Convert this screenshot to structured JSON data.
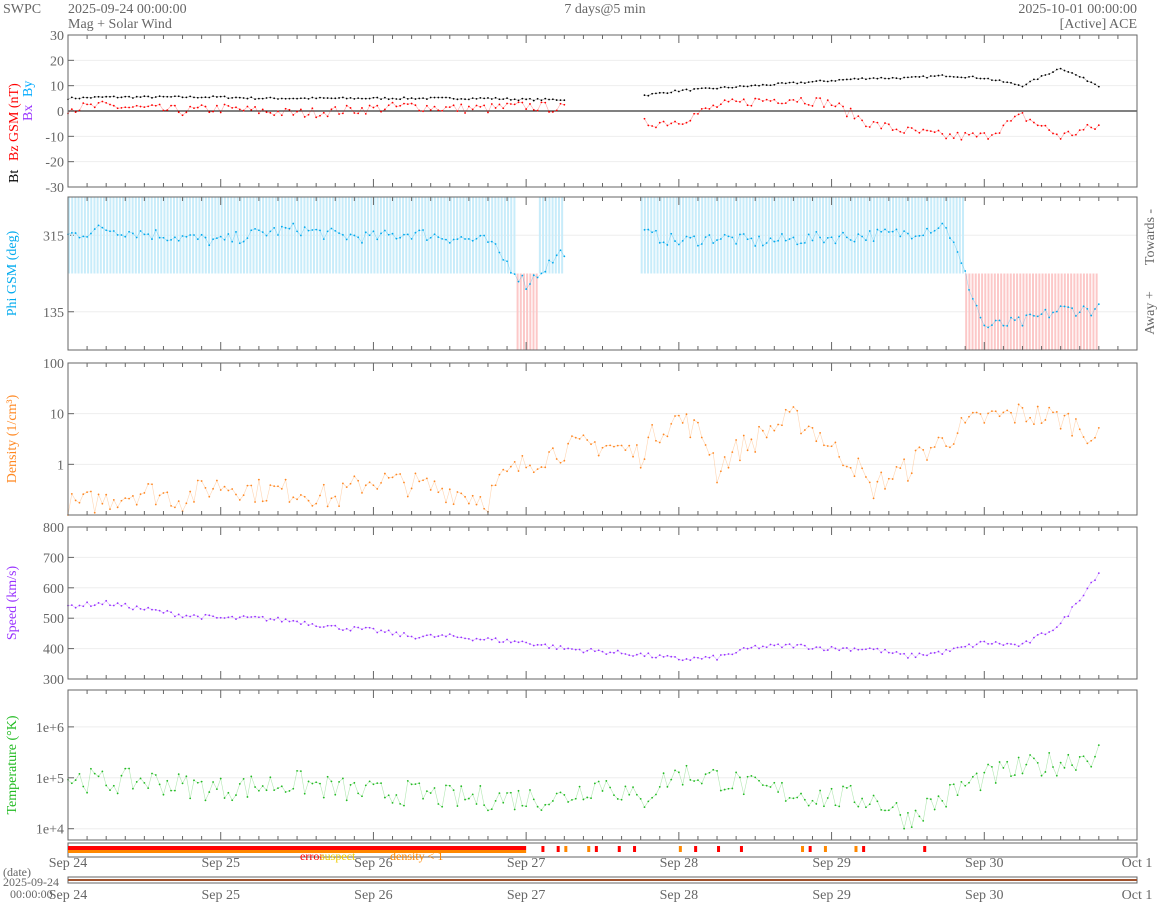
{
  "header": {
    "brand": "SWPC",
    "start": "2025-09-24 00:00:00",
    "subtitle": "Mag + Solar Wind",
    "span": "7 days@5 min",
    "end": "2025-10-01 00:00:00",
    "source": "[Active] ACE"
  },
  "chart_data": [
    {
      "type": "line",
      "title": "Mag",
      "ylabel_parts": [
        "Bt",
        "Bz GSM (nT)",
        "Bx",
        "By"
      ],
      "ylim": [
        -30,
        30
      ],
      "yticks": [
        "30",
        "20",
        "10",
        "0",
        "-10",
        "-20",
        "-30"
      ],
      "x_hours": [
        0,
        6,
        12,
        18,
        24,
        30,
        36,
        42,
        48,
        54,
        60,
        66,
        72,
        78,
        84,
        90,
        96,
        102,
        108,
        114,
        120,
        126,
        132,
        138,
        144,
        150,
        156,
        162
      ],
      "series": [
        {
          "name": "Bt",
          "color": "#000000",
          "values": [
            5,
            5.5,
            5.5,
            5.5,
            5.5,
            5,
            5,
            5,
            5,
            5,
            5,
            5,
            4.5,
            4.5,
            null,
            6,
            8,
            9,
            10,
            11,
            12,
            13,
            13,
            14,
            13,
            10,
            17,
            10
          ]
        },
        {
          "name": "Bz",
          "color": "#ff0000",
          "values": [
            1,
            2,
            1,
            0,
            1,
            0,
            -1,
            0,
            1,
            2,
            1,
            1,
            2,
            1,
            null,
            -5,
            -4,
            2,
            4,
            5,
            3,
            -5,
            -8,
            -10,
            -10,
            -2,
            -10,
            -6
          ]
        }
      ]
    },
    {
      "type": "scatter",
      "title": "Phi",
      "ylabel": "Phi GSM (deg)",
      "ylim": [
        45,
        405
      ],
      "yticks": [
        "315",
        "135"
      ],
      "right_labels": [
        "Towards -",
        "Away +"
      ],
      "series": [
        {
          "name": "Phi",
          "color": "#00aaee",
          "values": [
            315,
            330,
            320,
            310,
            300,
            320,
            330,
            315,
            310,
            320,
            310,
            300,
            200,
            280,
            null,
            320,
            300,
            310,
            300,
            305,
            310,
            315,
            320,
            340,
            100,
            110,
            140,
            140
          ]
        }
      ]
    },
    {
      "type": "line",
      "title": "Density",
      "ylabel": "Density (1/cm³)",
      "ylim": [
        0.1,
        100
      ],
      "yscale": "log",
      "yticks": [
        "100",
        "10",
        "1"
      ],
      "series": [
        {
          "name": "Density",
          "color": "#ff8822",
          "values": [
            0.15,
            0.2,
            0.3,
            0.2,
            0.4,
            0.3,
            0.3,
            0.2,
            0.5,
            0.4,
            0.3,
            0.2,
            1,
            2,
            2.5,
            1.5,
            8,
            0.7,
            3,
            8,
            2,
            0.3,
            0.8,
            3,
            8,
            10,
            8,
            3
          ]
        }
      ]
    },
    {
      "type": "line",
      "title": "Speed",
      "ylabel": "Speed (km/s)",
      "ylim": [
        300,
        800
      ],
      "yticks": [
        "800",
        "700",
        "600",
        "500",
        "400",
        "300"
      ],
      "series": [
        {
          "name": "Speed",
          "color": "#9933ff",
          "values": [
            540,
            550,
            530,
            510,
            500,
            500,
            490,
            470,
            460,
            440,
            440,
            430,
            420,
            400,
            390,
            380,
            365,
            370,
            405,
            410,
            400,
            400,
            375,
            390,
            420,
            410,
            480,
            650
          ]
        }
      ]
    },
    {
      "type": "line",
      "title": "Temperature",
      "ylabel": "Temperature (°K)",
      "ylim": [
        6000,
        5300000
      ],
      "yscale": "log",
      "yticks": [
        "1e+6",
        "1e+5",
        "1e+4"
      ],
      "series": [
        {
          "name": "Temperature",
          "color": "#22bb22",
          "values": [
            100000,
            80000,
            90000,
            70000,
            60000,
            70000,
            80000,
            60000,
            50000,
            50000,
            40000,
            40000,
            40000,
            40000,
            80000,
            30000,
            120000,
            100000,
            60000,
            50000,
            40000,
            40000,
            15000,
            40000,
            100000,
            150000,
            200000,
            300000
          ]
        }
      ]
    }
  ],
  "quality": {
    "legend": [
      "error",
      "suspect",
      "density < 1"
    ],
    "colors": [
      "#ff0000",
      "#ffcc00",
      "#ff8800"
    ]
  },
  "xaxis": {
    "ticks": [
      "Sep 24",
      "Sep 25",
      "Sep 26",
      "Sep 27",
      "Sep 28",
      "Sep 29",
      "Sep 30",
      "Oct 1"
    ]
  },
  "date_strip": {
    "label": "(date)",
    "date": "2025-09-24",
    "time": "00:00:00"
  }
}
